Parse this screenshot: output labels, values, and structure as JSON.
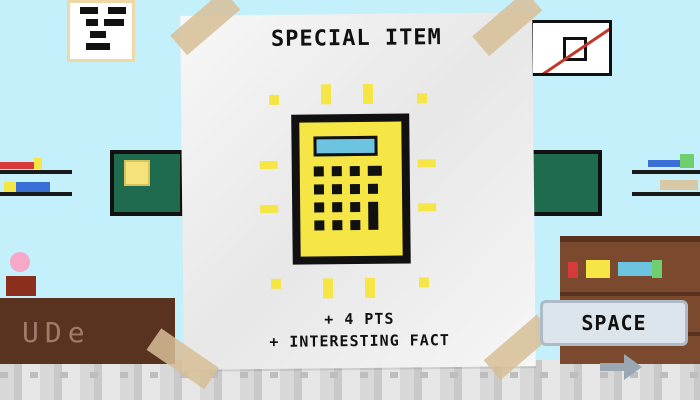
{
  "card": {
    "title": "SPECIAL ITEM",
    "item_icon": "calculator-icon",
    "reward_points": "+ 4 PTS",
    "reward_extra": "+ INTERESTING FACT"
  },
  "desk_sign": "UDe",
  "controls": {
    "space_label": "SPACE",
    "arrow_icon": "arrow-right-icon"
  },
  "colors": {
    "wall": "#c3f0fa",
    "calculator": "#f5e645",
    "calculator_screen": "#6cc4e0",
    "board": "#1f6b4e",
    "cabinet": "#7b4a2e"
  }
}
